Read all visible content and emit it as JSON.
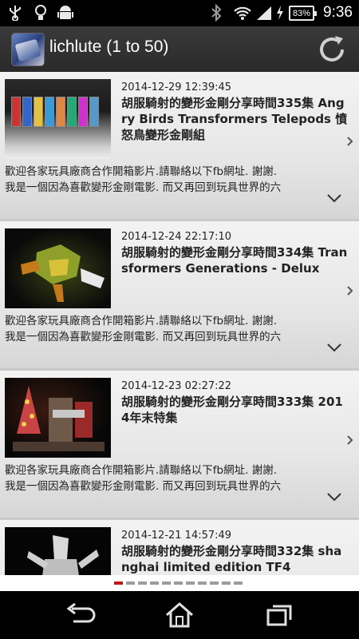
{
  "status_bar": {
    "icons": [
      "usb-icon",
      "lightbulb-icon",
      "android-icon",
      "bluetooth-icon",
      "wifi-icon",
      "signal-icon",
      "charging-icon",
      "battery-icon"
    ],
    "battery_level": "83%",
    "time": "9:36"
  },
  "action_bar": {
    "title": "lichlute (1 to 50)",
    "refresh_icon": "refresh-icon"
  },
  "videos": [
    {
      "date": "2014-12-29 12:39:45",
      "title": "胡服騎射的變形金剛分享時間335集 Angry Birds Transformers Telepods 憤怒鳥變形金剛組",
      "description": "歡迎各家玩具廠商合作開箱影片.請聯絡以下fb網址. 謝謝.\n我是一個因為喜歡變形金剛電影. 而又再回到玩具世界的六"
    },
    {
      "date": "2014-12-24 22:17:10",
      "title": "胡服騎射的變形金剛分享時間334集 Transformers Generations - Delux",
      "description": "歡迎各家玩具廠商合作開箱影片.請聯絡以下fb網址. 謝謝.\n我是一個因為喜歡變形金剛電影. 而又再回到玩具世界的六"
    },
    {
      "date": "2014-12-23 02:27:22",
      "title": "胡服騎射的變形金剛分享時間333集 2014年末特集",
      "description": "歡迎各家玩具廠商合作開箱影片.請聯絡以下fb網址. 謝謝.\n我是一個因為喜歡變形金剛電影. 而又再回到玩具世界的六"
    },
    {
      "date": "2014-12-21 14:57:49",
      "title": "胡服騎射的變形金剛分享時間332集 shanghai limited edition TF4",
      "description": ""
    }
  ],
  "pager": {
    "total_dots": 11,
    "active_index": 0
  },
  "nav_bar": {
    "buttons": [
      "back-icon",
      "home-icon",
      "recent-apps-icon"
    ]
  }
}
